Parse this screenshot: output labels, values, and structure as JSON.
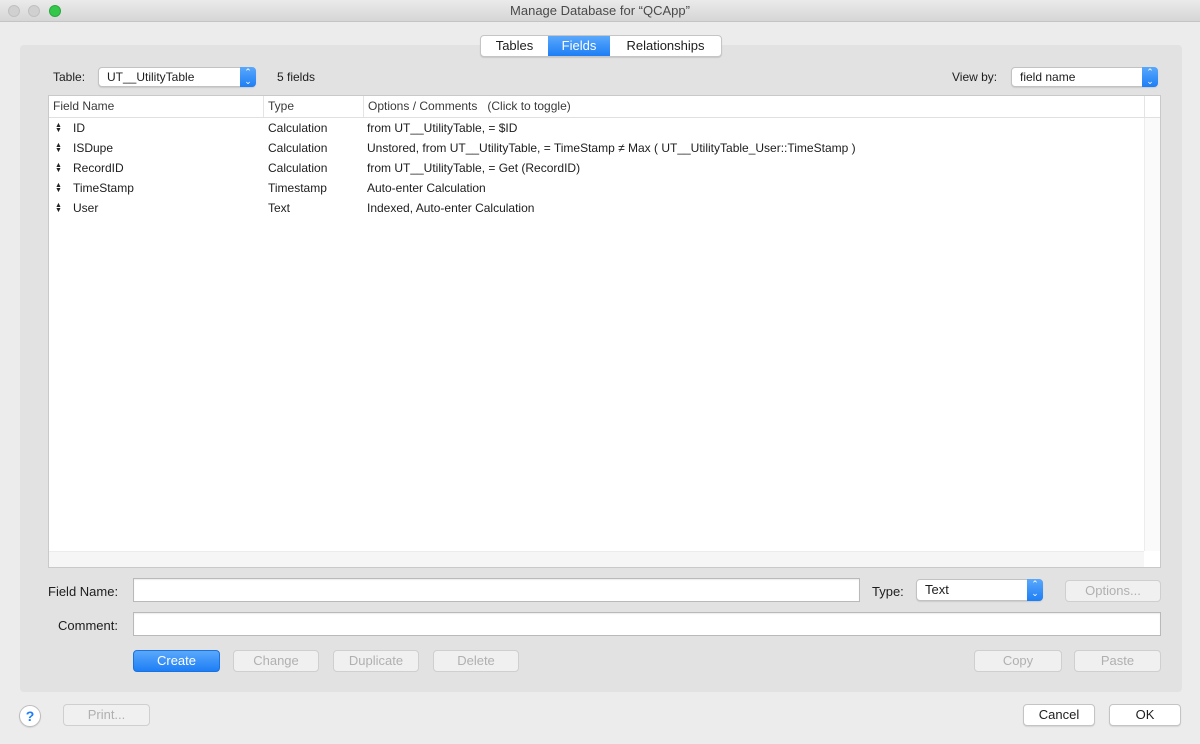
{
  "window": {
    "title": "Manage Database for “QCApp”"
  },
  "tabs": [
    {
      "label": "Tables",
      "selected": false
    },
    {
      "label": "Fields",
      "selected": true
    },
    {
      "label": "Relationships",
      "selected": false
    }
  ],
  "toolbar": {
    "table_label": "Table:",
    "table_value": "UT__UtilityTable",
    "field_count": "5 fields",
    "viewby_label": "View by:",
    "viewby_value": "field name"
  },
  "table": {
    "columns": [
      "Field Name",
      "Type",
      "Options / Comments   (Click to toggle)"
    ],
    "rows": [
      {
        "name": "ID",
        "type": "Calculation",
        "options": "from UT__UtilityTable, = $ID"
      },
      {
        "name": "ISDupe",
        "type": "Calculation",
        "options": "Unstored, from UT__UtilityTable, = TimeStamp ≠ Max ( UT__UtilityTable_User::TimeStamp )"
      },
      {
        "name": "RecordID",
        "type": "Calculation",
        "options": "from UT__UtilityTable, = Get (RecordID)"
      },
      {
        "name": "TimeStamp",
        "type": "Timestamp",
        "options": "Auto-enter Calculation"
      },
      {
        "name": "User",
        "type": "Text",
        "options": "Indexed, Auto-enter Calculation"
      }
    ]
  },
  "form": {
    "field_name_label": "Field Name:",
    "field_name_value": "",
    "type_label": "Type:",
    "type_value": "Text",
    "options_button": "Options...",
    "comment_label": "Comment:",
    "comment_value": ""
  },
  "actions": {
    "create": "Create",
    "change": "Change",
    "duplicate": "Duplicate",
    "delete": "Delete",
    "copy": "Copy",
    "paste": "Paste"
  },
  "footer": {
    "help": "?",
    "print": "Print...",
    "cancel": "Cancel",
    "ok": "OK"
  },
  "icons": {
    "row_handle": "↕",
    "popup_arrows": "⌃⌄"
  },
  "colors": {
    "accent": "#1d7ef5",
    "close_light": "#d0d0d0",
    "zoom_light": "#34c84a"
  }
}
